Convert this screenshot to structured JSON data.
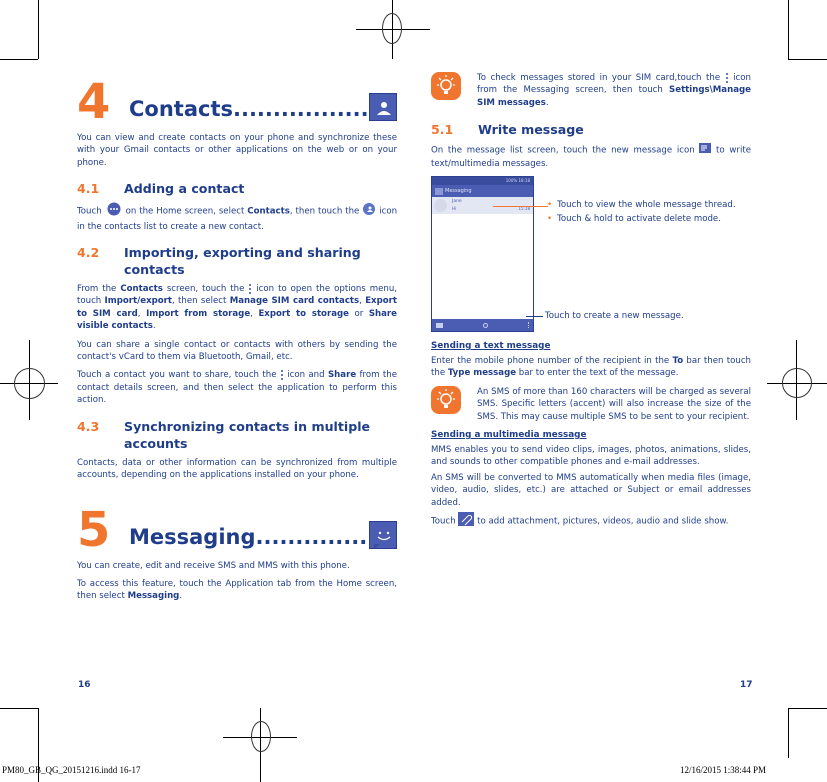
{
  "left_page": {
    "chapter": {
      "number": "4",
      "title": "Contacts...................",
      "icon": "contacts-app-icon"
    },
    "intro": "You can view and create contacts on your phone and synchronize these with your Gmail contacts or other applications on the web or on your phone.",
    "sections": [
      {
        "number": "4.1",
        "title": "Adding a contact",
        "paragraphs": [
          {
            "p1": "Touch",
            "icon1": "app-drawer-icon",
            "p2": " on the Home screen, select ",
            "b1": "Contacts",
            "p3": ", then touch the",
            "icon2": "add-contact-icon",
            "p4": " icon in the contacts list to create a new contact."
          }
        ]
      },
      {
        "number": "4.2",
        "title": "Importing, exporting and sharing contacts",
        "paragraphs": [
          {
            "p1": "From the ",
            "b1": "Contacts",
            "p2": " screen, touch the ",
            "icon": "more-options-icon",
            "p3": " icon to open the options menu, touch ",
            "b2": "Import/export",
            "p4": ", then select ",
            "b3": "Manage SIM card contacts",
            "p5": ", ",
            "b4": "Export to SIM card",
            "p6": ", ",
            "b5": "Import from storage",
            "p7": ", ",
            "b6": "Export to storage",
            "p8": " or ",
            "b7": "Share visible contacts",
            "p9": "."
          },
          {
            "text": "You can share a single contact or contacts with others by sending the contact's vCard to them via Bluetooth, Gmail, etc."
          },
          {
            "p1": "Touch a contact you want to share, touch the ",
            "icon": "more-options-icon",
            "p2": " icon and ",
            "b1": "Share",
            "p3": " from the contact details screen, and then select the application to perform this action."
          }
        ]
      },
      {
        "number": "4.3",
        "title": "Synchronizing contacts in multiple accounts",
        "paragraphs": [
          {
            "text": "Contacts, data or other information can be synchronized from multiple accounts, depending on the applications installed on your phone."
          }
        ]
      }
    ],
    "chapter2": {
      "number": "5",
      "title": "Messaging.................",
      "icon": "messaging-app-icon"
    },
    "chapter2_paragraphs": [
      {
        "text": "You can create, edit and receive SMS and MMS with this phone."
      },
      {
        "p1": "To access this feature, touch the Application tab from the Home screen, then select ",
        "b1": "Messaging",
        "p2": "."
      }
    ],
    "page_number": "16"
  },
  "right_page": {
    "tip1": {
      "icon": "lightbulb-tip-icon",
      "p1": "To check messages stored in your SIM card,touch the ",
      "icon_inline": "more-options-icon",
      "p2": " icon from the Messaging screen, then touch ",
      "b1": "Settings\\Manage SIM messages",
      "p3": "."
    },
    "section": {
      "number": "5.1",
      "title": "Write message",
      "intro_p1": "On the message list screen, touch the new message icon ",
      "intro_icon": "new-message-icon",
      "intro_p2": " to write text/multimedia messages."
    },
    "phone_screenshot": {
      "status_bar": {
        "time": "18:18",
        "battery": "100%"
      },
      "app_bar_title": "Messaging",
      "thread": {
        "name": "Jane",
        "preview": "Hi",
        "time": "15:18"
      },
      "bottom_bar_icons": [
        "new-message-icon",
        "search-icon",
        "more-options-icon"
      ]
    },
    "callouts": {
      "thread_1": "Touch to view the whole message thread.",
      "thread_2": "Touch & hold to activate delete mode.",
      "new_message": "Touch to create a new message."
    },
    "sending_text": {
      "heading": "Sending a text message",
      "p1": "Enter the mobile phone number of the recipient in the ",
      "b1": "To",
      "p2": " bar then touch the ",
      "b2": "Type message",
      "p3": " bar to enter the text of the message."
    },
    "tip2": {
      "icon": "lightbulb-tip-icon",
      "text": "An SMS of more than 160 characters will be charged as several SMS. Specific letters (accent) will also increase the size of the SMS. This may cause multiple SMS to be sent to your recipient."
    },
    "sending_mms": {
      "heading": "Sending a multimedia message",
      "para1": "MMS enables you to send video clips, images, photos, animations, slides, and sounds to other compatible phones and e-mail addresses.",
      "para2": "An SMS will be converted to MMS automatically when media files (image, video, audio, slides, etc.) are attached or Subject or email addresses added.",
      "para3_p1": "Touch ",
      "para3_icon": "attachment-icon",
      "para3_p2": " to add attachment, pictures, videos, audio and slide show."
    },
    "page_number": "17"
  },
  "footer": {
    "file": "PM80_GB_QG_20151216.indd   16-17",
    "timestamp": "12/16/2015   1:38:44 PM"
  },
  "colors": {
    "heading_blue": "#1f3d8a",
    "accent_orange": "#f07630",
    "icon_blue": "#4a5db3"
  }
}
